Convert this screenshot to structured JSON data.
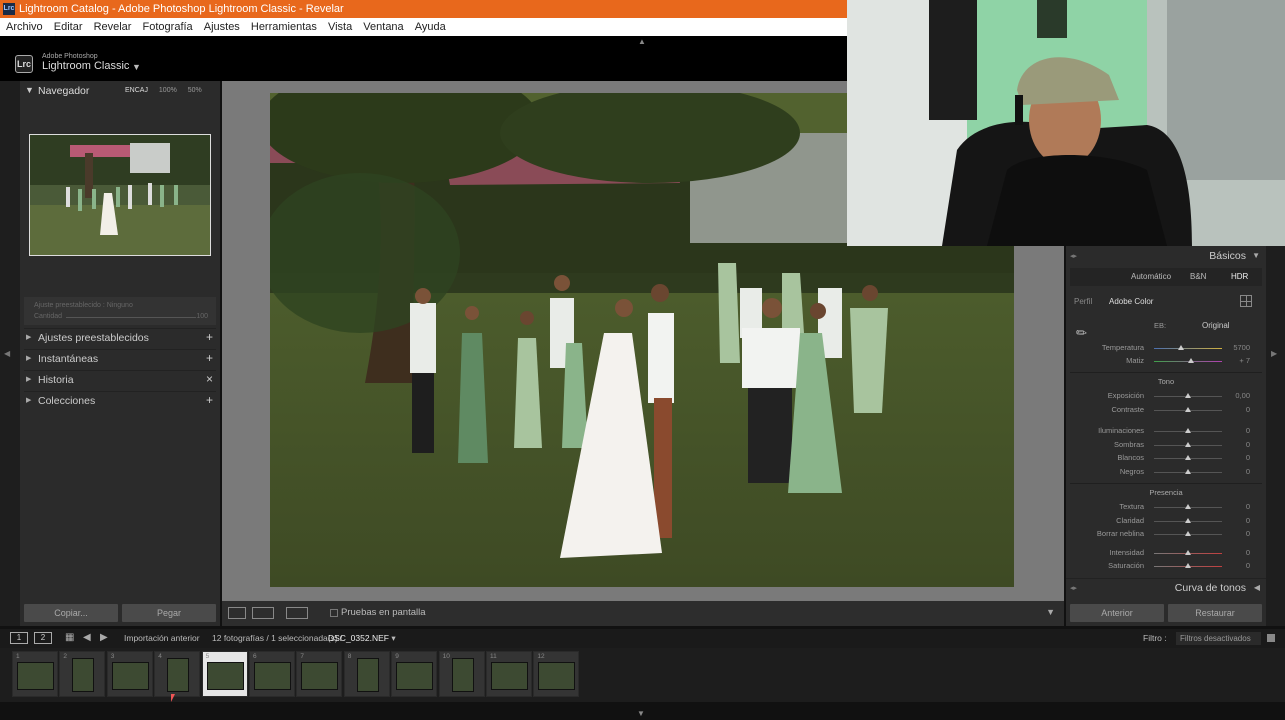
{
  "window": {
    "title": "Lightroom Catalog - Adobe Photoshop Lightroom Classic - Revelar",
    "app_icon": "Lrc"
  },
  "menu": [
    "Archivo",
    "Editar",
    "Revelar",
    "Fotografía",
    "Ajustes",
    "Herramientas",
    "Vista",
    "Ventana",
    "Ayuda"
  ],
  "identity": {
    "badge": "Lrc",
    "brand_top": "Adobe Photoshop",
    "brand_main": "Lightroom Classic"
  },
  "left_panel": {
    "navigator": {
      "title": "Navegador",
      "options": [
        "ENCAJ",
        "100%",
        "50%"
      ]
    },
    "preset_box": {
      "line1": "Ajuste preestablecido : Ninguno",
      "line2": "Cantidad",
      "value": "100"
    },
    "sections": [
      {
        "label": "Ajustes preestablecidos",
        "action": "+"
      },
      {
        "label": "Instantáneas",
        "action": "+"
      },
      {
        "label": "Historia",
        "action": "×"
      },
      {
        "label": "Colecciones",
        "action": "+"
      }
    ],
    "buttons": {
      "copy": "Copiar...",
      "paste": "Pegar"
    }
  },
  "toolbar": {
    "proof_label": "Pruebas en pantalla"
  },
  "right_panel": {
    "title": "Básicos",
    "treatment": {
      "auto": "Automático",
      "bw": "B&N",
      "hdr": "HDR"
    },
    "profile": {
      "label": "Perfil",
      "value": "Adobe Color"
    },
    "wb": {
      "label": "EB:",
      "value": "Original"
    },
    "white_balance": [
      {
        "label": "Temperatura",
        "value": "5700"
      },
      {
        "label": "Matiz",
        "value": "+ 7"
      }
    ],
    "tone_title": "Tono",
    "tone": [
      {
        "label": "Exposición",
        "value": "0,00"
      },
      {
        "label": "Contraste",
        "value": "0"
      },
      {
        "label": "Iluminaciones",
        "value": "0"
      },
      {
        "label": "Sombras",
        "value": "0"
      },
      {
        "label": "Blancos",
        "value": "0"
      },
      {
        "label": "Negros",
        "value": "0"
      }
    ],
    "presence_title": "Presencia",
    "presence": [
      {
        "label": "Textura",
        "value": "0"
      },
      {
        "label": "Claridad",
        "value": "0"
      },
      {
        "label": "Borrar neblina",
        "value": "0"
      },
      {
        "label": "Intensidad",
        "value": "0"
      },
      {
        "label": "Saturación",
        "value": "0"
      }
    ],
    "curve_title": "Curva de tonos",
    "buttons": {
      "previous": "Anterior",
      "reset": "Restaurar"
    }
  },
  "filmstrip": {
    "screen1": "1",
    "screen2": "2",
    "source": "Importación anterior",
    "count": "12 fotografías / 1 seleccionada(s) /",
    "filename": "DSC_0352.NEF",
    "filter_label": "Filtro :",
    "filter_value": "Filtros desactivados",
    "cells": [
      "1",
      "2",
      "3",
      "4",
      "5",
      "6",
      "7",
      "8",
      "9",
      "10",
      "11",
      "12"
    ]
  }
}
